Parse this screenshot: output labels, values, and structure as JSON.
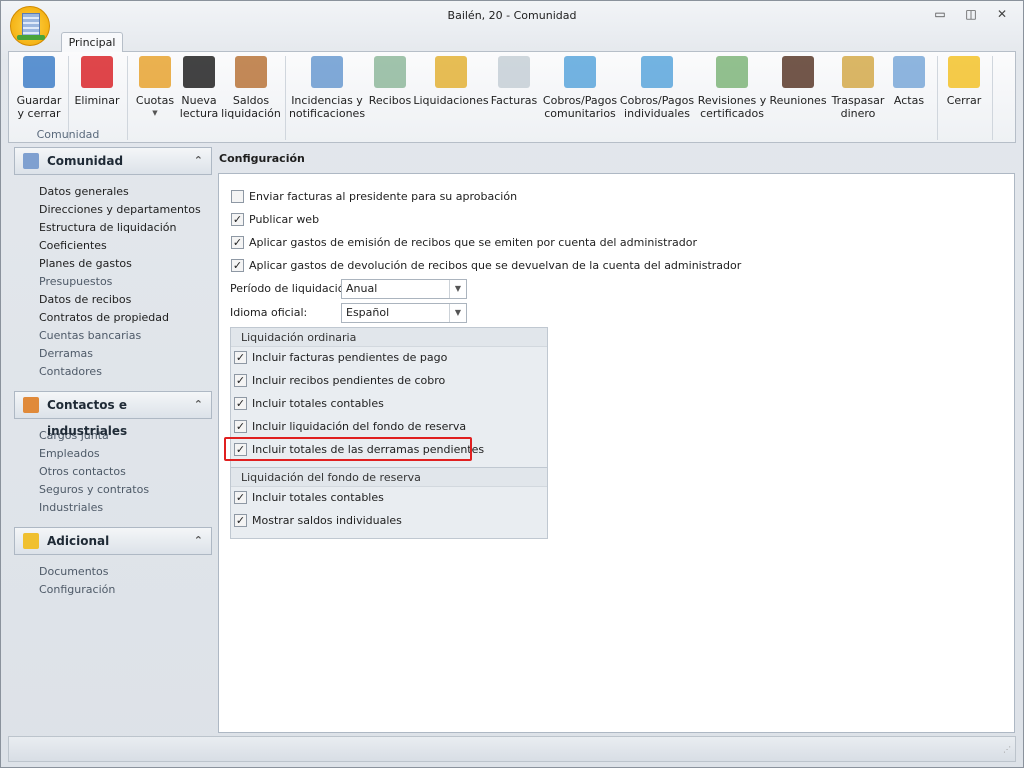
{
  "window": {
    "title": "Bailén, 20 - Comunidad"
  },
  "tabs": [
    {
      "label": "Principal",
      "active": true
    }
  ],
  "ribbon": {
    "group_label": "Comunidad",
    "buttons": [
      {
        "label": "Guardar\ny cerrar",
        "icon": "save-icon"
      },
      {
        "label": "Eliminar",
        "icon": "delete-icon"
      },
      {
        "label": "Cuotas",
        "icon": "calendar-coins-icon",
        "dropdown": true
      },
      {
        "label": "Nueva\nlectura",
        "icon": "counter-icon"
      },
      {
        "label": "Saldos\nliquidación",
        "icon": "scales-icon"
      },
      {
        "label": "Incidencias y\nnotificaciones",
        "icon": "clipboard-check-icon"
      },
      {
        "label": "Recibos",
        "icon": "receipt-icon"
      },
      {
        "label": "Liquidaciones",
        "icon": "certificate-icon"
      },
      {
        "label": "Facturas",
        "icon": "invoice-icon"
      },
      {
        "label": "Cobros/Pagos\ncomunitarios",
        "icon": "calculator-icon"
      },
      {
        "label": "Cobros/Pagos\nindividuales",
        "icon": "calculator-person-icon"
      },
      {
        "label": "Revisiones y\ncertificados",
        "icon": "bell-notebook-icon"
      },
      {
        "label": "Reuniones",
        "icon": "people-meeting-icon"
      },
      {
        "label": "Traspasar\ndinero",
        "icon": "money-transfer-icon"
      },
      {
        "label": "Actas",
        "icon": "diploma-icon"
      },
      {
        "label": "Cerrar",
        "icon": "folder-exit-icon"
      }
    ]
  },
  "sidebar": {
    "sections": [
      {
        "title": "Comunidad",
        "items": [
          "Datos generales",
          "Direcciones y departamentos",
          "Estructura de liquidación",
          "Coeficientes",
          "Planes de gastos",
          "Presupuestos",
          "Datos de recibos",
          "Contratos de propiedad",
          "Cuentas bancarias",
          "Derramas",
          "Contadores"
        ]
      },
      {
        "title": "Contactos e industriales",
        "items": [
          "Cargos junta",
          "Empleados",
          "Otros contactos",
          "Seguros y contratos",
          "Industriales"
        ]
      },
      {
        "title": "Adicional",
        "items": [
          "Documentos",
          "Configuración"
        ]
      }
    ]
  },
  "main": {
    "title": "Configuración",
    "options": [
      {
        "label": "Enviar facturas al presidente para su aprobación",
        "checked": false
      },
      {
        "label": "Publicar web",
        "checked": true
      },
      {
        "label": "Aplicar gastos de emisión de recibos que se emiten por cuenta del administrador",
        "checked": true
      },
      {
        "label": "Aplicar gastos de devolución de recibos que se devuelvan de la cuenta del administrador",
        "checked": true
      }
    ],
    "periodo": {
      "label": "Período de liquidación:",
      "value": "Anual"
    },
    "idioma": {
      "label": "Idioma oficial:",
      "value": "Español"
    },
    "group1": {
      "title": "Liquidación ordinaria",
      "items": [
        {
          "label": "Incluir facturas pendientes de pago",
          "checked": true
        },
        {
          "label": "Incluir recibos pendientes de cobro",
          "checked": true
        },
        {
          "label": "Incluir totales contables",
          "checked": true
        },
        {
          "label": "Incluir liquidación del fondo de reserva",
          "checked": true
        },
        {
          "label": "Incluir totales de las derramas pendientes",
          "checked": true
        }
      ]
    },
    "group2": {
      "title": "Liquidación del fondo de reserva",
      "items": [
        {
          "label": "Incluir totales contables",
          "checked": true
        },
        {
          "label": "Mostrar saldos individuales",
          "checked": true
        }
      ]
    }
  },
  "colors": {
    "highlight": "#e02020",
    "background": "#e9edf1"
  }
}
